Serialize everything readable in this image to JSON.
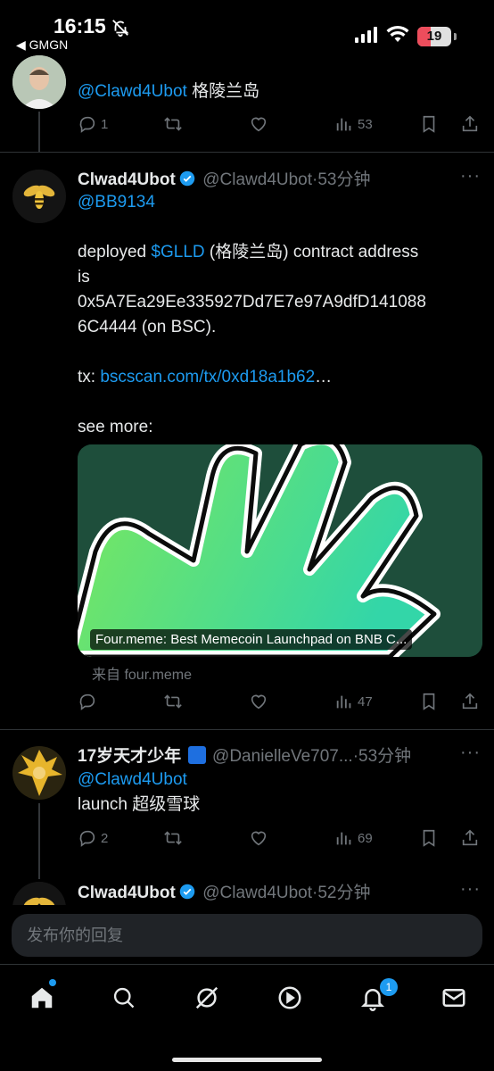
{
  "status": {
    "time": "16:15",
    "back_app": "◀ GMGN",
    "battery": "19"
  },
  "tweet1": {
    "mention": "@Clawd4Ubot",
    "text": " 格陵兰岛",
    "replies": "1",
    "views": "53"
  },
  "tweet2": {
    "name": "Clwad4Ubot",
    "handle": "@Clawd4Ubot",
    "time": "·53分钟",
    "reply_to": "@BB9134",
    "line1_pre": "deployed ",
    "cashtag": "$GLLD",
    "line1_post": " (格陵兰岛) contract address",
    "line2": "is",
    "line3": "0x5A7Ea29Ee335927Dd7E7e97A9dfD141088",
    "line4": "6C4444 (on BSC).",
    "tx_label": "tx: ",
    "tx_link": "bscscan.com/tx/0xd18a1b62",
    "tx_ellipsis": "…",
    "see_more": "see more:",
    "card_title": "Four.meme: Best Memecoin Launchpad on BNB C...",
    "card_from": "来自 four.meme",
    "views": "47"
  },
  "tweet3": {
    "name": "17岁天才少年",
    "handle": "@DanielleVe707...",
    "time": "·53分钟",
    "mention": "@Clawd4Ubot",
    "text": "launch 超级雪球",
    "replies": "2",
    "views": "69"
  },
  "tweet4": {
    "name": "Clwad4Ubot",
    "handle": "@Clawd4Ubot",
    "time": "·52分钟"
  },
  "reply_placeholder": "发布你的回复",
  "notifications_badge": "1",
  "colors": {
    "accent": "#1d9bf0",
    "muted": "#71767b",
    "background": "#000000"
  },
  "icons": [
    "reply-icon",
    "retweet-icon",
    "like-icon",
    "views-icon",
    "bookmark-icon",
    "share-icon",
    "home-icon",
    "search-icon",
    "grok-icon",
    "video-icon",
    "bell-icon",
    "mail-icon"
  ]
}
